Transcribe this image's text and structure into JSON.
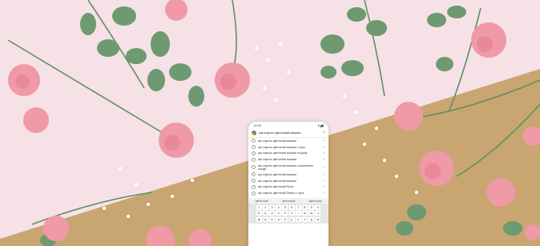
{
  "phone": {
    "status_time": "12:00",
    "status_icons": "▾◢▮",
    "search_query": "как открыть цветочный магазин",
    "close_glyph": "×",
    "suggestions": [
      {
        "text": "как открыть цветочный магазин"
      },
      {
        "text": "как открыть цветочный магазин с нуля"
      },
      {
        "text": "как открыть цветочный магазин на дому"
      },
      {
        "text": "как открыть цветочный магазин"
      },
      {
        "text": "как открыть цветочный магазин в маленьком городе"
      },
      {
        "text": "как открыть цветочный магазин"
      },
      {
        "text": "как открыть цветочный магазин"
      },
      {
        "text": "как открыть цветочный бутик"
      },
      {
        "text": "как открыть цветочный бизнес с нуля"
      }
    ],
    "word_strip": [
      "цветочный",
      "цветочный",
      "цветочная"
    ],
    "keyboard_rows": [
      [
        "1",
        "2",
        "3",
        "4",
        "5",
        "6",
        "7",
        "8",
        "9",
        "0"
      ],
      [
        "й",
        "ц",
        "у",
        "к",
        "е",
        "н",
        "г",
        "ш",
        "щ",
        "з"
      ],
      [
        "ф",
        "ы",
        "в",
        "а",
        "п",
        "р",
        "о",
        "л",
        "д",
        "ж"
      ]
    ]
  },
  "colors": {
    "pink_background": "#f6e1e7",
    "cork": "#c9a571",
    "carnation": "#ef9aa6",
    "leaf": "#5f8f63"
  },
  "icons": [
    "google-logo-icon",
    "close-icon",
    "search-history-icon",
    "arrow-icon"
  ]
}
